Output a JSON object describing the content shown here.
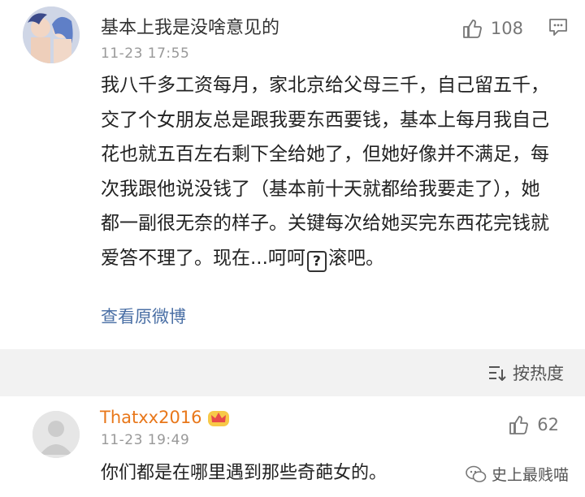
{
  "comment1": {
    "username": "基本上我是没啥意见的",
    "time": "11-23 17:55",
    "likes": "108",
    "text_before_icon": "我八千多工资每月，家北京给父母三千，自己留五千，交了个女朋友总是跟我要东西要钱，基本上每月我自己花也就五百左右剩下全给她了，但她好像并不满足，每次我跟他说没钱了（基本前十天就都给我要走了），她都一副很无奈的样子。关键每次给她买完东西花完钱就爱答不理了。现在...呵呵",
    "icon_glyph": "?",
    "text_after_icon": "滚吧。",
    "view_original": "查看原微博"
  },
  "sort": {
    "label": "按热度"
  },
  "comment2": {
    "username": "Thatxx2016",
    "time": "11-23 19:49",
    "likes": "62",
    "text": "你们都是在哪里遇到那些奇葩女的。"
  },
  "watermark": {
    "text": "史上最贱喵"
  },
  "colors": {
    "username_orange": "#e8771a",
    "link_blue": "#4a6fa5",
    "background_gray": "#f2f2f2"
  }
}
